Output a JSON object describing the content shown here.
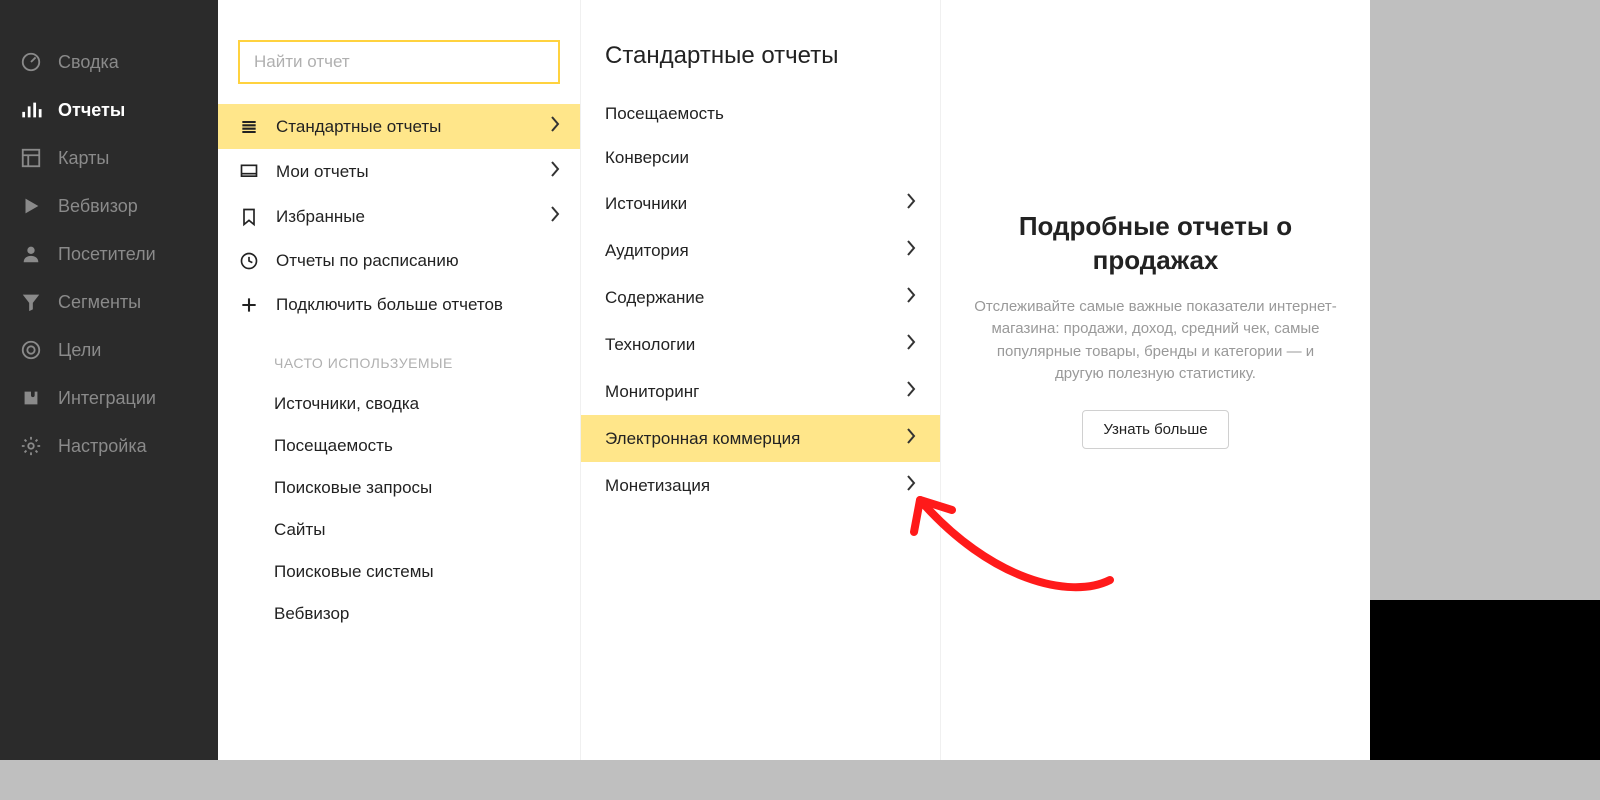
{
  "nav": {
    "items": [
      {
        "label": "Сводка"
      },
      {
        "label": "Отчеты"
      },
      {
        "label": "Карты"
      },
      {
        "label": "Вебвизор"
      },
      {
        "label": "Посетители"
      },
      {
        "label": "Сегменты"
      },
      {
        "label": "Цели"
      },
      {
        "label": "Интеграции"
      },
      {
        "label": "Настройка"
      }
    ]
  },
  "search": {
    "placeholder": "Найти отчет"
  },
  "reports": {
    "items": [
      {
        "label": "Стандартные отчеты"
      },
      {
        "label": "Мои отчеты"
      },
      {
        "label": "Избранные"
      },
      {
        "label": "Отчеты по расписанию"
      },
      {
        "label": "Подключить больше отчетов"
      }
    ],
    "freq_header": "ЧАСТО ИСПОЛЬЗУЕМЫЕ",
    "frequent": [
      "Источники, сводка",
      "Посещаемость",
      "Поисковые запросы",
      "Сайты",
      "Поисковые системы",
      "Вебвизор"
    ]
  },
  "standard": {
    "title": "Стандартные отчеты",
    "items": [
      {
        "label": "Посещаемость",
        "expandable": false
      },
      {
        "label": "Конверсии",
        "expandable": false
      },
      {
        "label": "Источники",
        "expandable": true
      },
      {
        "label": "Аудитория",
        "expandable": true
      },
      {
        "label": "Содержание",
        "expandable": true
      },
      {
        "label": "Технологии",
        "expandable": true
      },
      {
        "label": "Мониторинг",
        "expandable": true
      },
      {
        "label": "Электронная коммерция",
        "expandable": true
      },
      {
        "label": "Монетизация",
        "expandable": true
      }
    ]
  },
  "info": {
    "title": "Подробные отчеты о продажах",
    "text": "Отслеживайте самые важные показатели интернет-магазина: продажи, доход, средний чек, самые популярные товары, бренды и категории — и другую полезную статистику.",
    "button": "Узнать больше"
  }
}
